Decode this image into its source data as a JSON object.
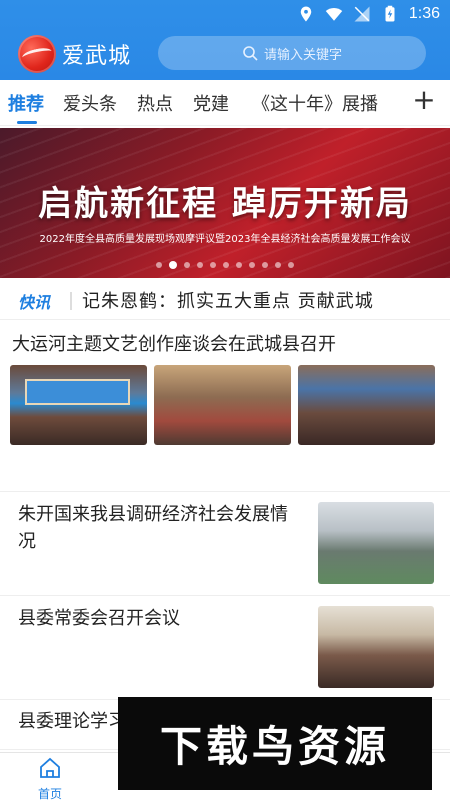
{
  "status_bar": {
    "time": "1:36"
  },
  "app": {
    "brand": "爱武城"
  },
  "search": {
    "placeholder": "请输入关键字"
  },
  "tabs": [
    {
      "label": "推荐",
      "active": true
    },
    {
      "label": "爱头条"
    },
    {
      "label": "热点"
    },
    {
      "label": "党建"
    },
    {
      "label": "《这十年》展播"
    }
  ],
  "banner": {
    "title": "启航新征程  踔厉开新局",
    "subtitle": "2022年度全县高质量发展现场观摩评议暨2023年全县经济社会高质量发展工作会议",
    "page_count": 11,
    "active_index": 1
  },
  "ticker": {
    "label": "快讯",
    "text": "记朱恩鹤：抓实五大重点  贡献武城"
  },
  "news": [
    {
      "title": "大运河主题文艺创作座谈会在武城县召开"
    },
    {
      "title": "朱开国来我县调研经济社会发展情况"
    },
    {
      "title": "县委常委会召开会议"
    },
    {
      "title": "县委理论学习中心组..."
    }
  ],
  "bottom_nav": {
    "home_label": "首页"
  },
  "watermark": {
    "text": "下载鸟资源"
  },
  "colors": {
    "primary": "#2a88e6",
    "accent": "#1e7fe0",
    "banner_red": "#c0202a"
  }
}
